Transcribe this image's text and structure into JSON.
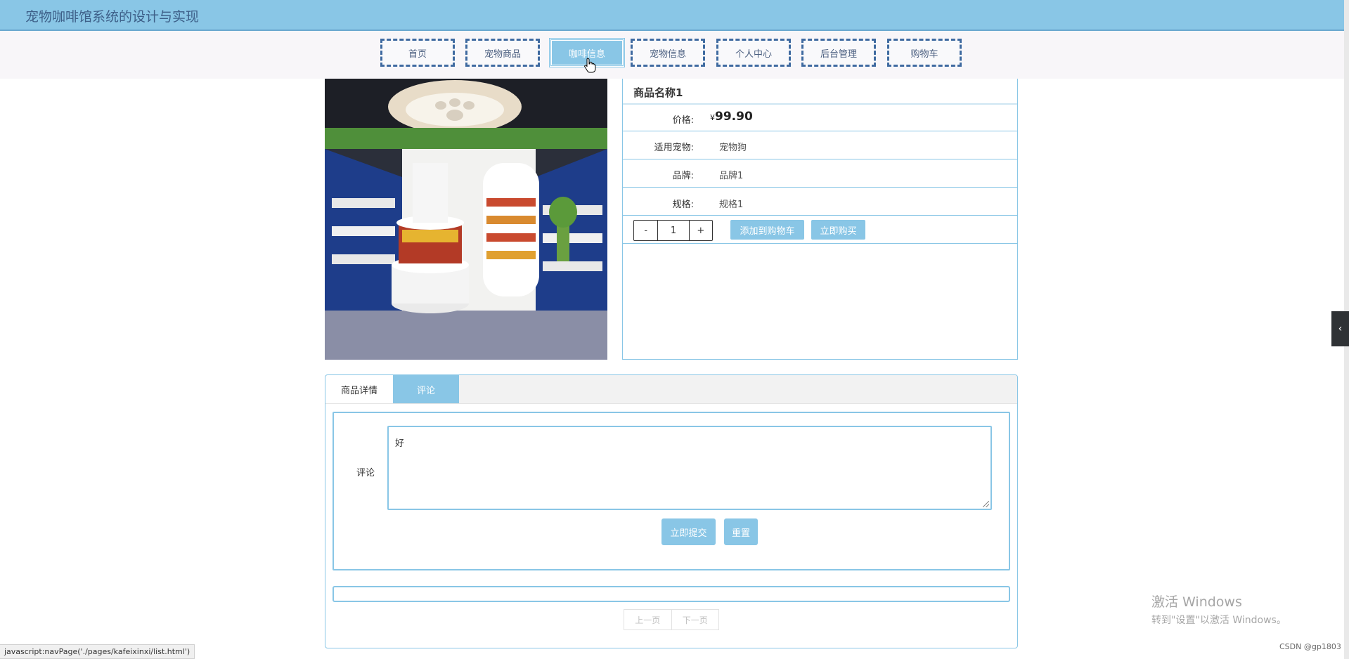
{
  "header": {
    "title": "宠物咖啡馆系统的设计与实现"
  },
  "nav": {
    "items": [
      {
        "label": "首页"
      },
      {
        "label": "宠物商品"
      },
      {
        "label": "咖啡信息"
      },
      {
        "label": "宠物信息"
      },
      {
        "label": "个人中心"
      },
      {
        "label": "后台管理"
      },
      {
        "label": "购物车"
      }
    ],
    "active_index": 2
  },
  "product": {
    "name": "商品名称1",
    "price_label": "价格:",
    "currency": "¥",
    "price": "99.90",
    "fields": [
      {
        "label": "适用宠物:",
        "value": "宠物狗"
      },
      {
        "label": "品牌:",
        "value": "品牌1"
      },
      {
        "label": "规格:",
        "value": "规格1"
      }
    ],
    "quantity": {
      "minus": "-",
      "value": "1",
      "plus": "+"
    },
    "add_to_cart_label": "添加到购物车",
    "buy_now_label": "立即购买"
  },
  "tabs": [
    {
      "label": "商品详情"
    },
    {
      "label": "评论"
    }
  ],
  "comment_form": {
    "label": "评论",
    "value": "好",
    "submit_label": "立即提交",
    "reset_label": "重置"
  },
  "pager": {
    "prev_label": "上一页",
    "next_label": "下一页"
  },
  "status_bar": {
    "text": "javascript:navPage('./pages/kafeixinxi/list.html')"
  },
  "watermark": {
    "line1": "激活 Windows",
    "line2": "转到\"设置\"以激活 Windows。"
  },
  "footer_credit": "CSDN @gp1803",
  "colors": {
    "accent": "#89c6e6",
    "nav_border": "#3f6aa0",
    "title_text": "#3d5f88"
  }
}
